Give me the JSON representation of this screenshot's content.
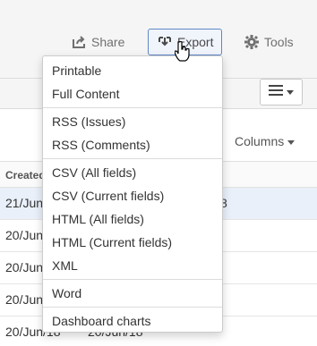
{
  "header": {
    "share_label": "Share",
    "export_label": "Export",
    "tools_label": "Tools"
  },
  "toolbar": {
    "columns_label": "Columns"
  },
  "table": {
    "header_created": "Created",
    "rows": [
      {
        "created": "21/Jun",
        "extra": "8"
      },
      {
        "created": "20/Jun",
        "extra": ""
      },
      {
        "created": "20/Jun",
        "extra": ""
      },
      {
        "created": "20/Jun",
        "extra": ""
      },
      {
        "created": "20/Jun/18",
        "extra": "20/Jun/18"
      }
    ]
  },
  "export_menu": {
    "groups": [
      [
        "Printable",
        "Full Content"
      ],
      [
        "RSS (Issues)",
        "RSS (Comments)"
      ],
      [
        "CSV (All fields)",
        "CSV (Current fields)",
        "HTML (All fields)",
        "HTML (Current fields)",
        "XML"
      ],
      [
        "Word"
      ],
      [
        "Dashboard charts"
      ]
    ]
  },
  "colors": {
    "accent": "#5f87c6",
    "selected_row": "#e9f0fa"
  }
}
